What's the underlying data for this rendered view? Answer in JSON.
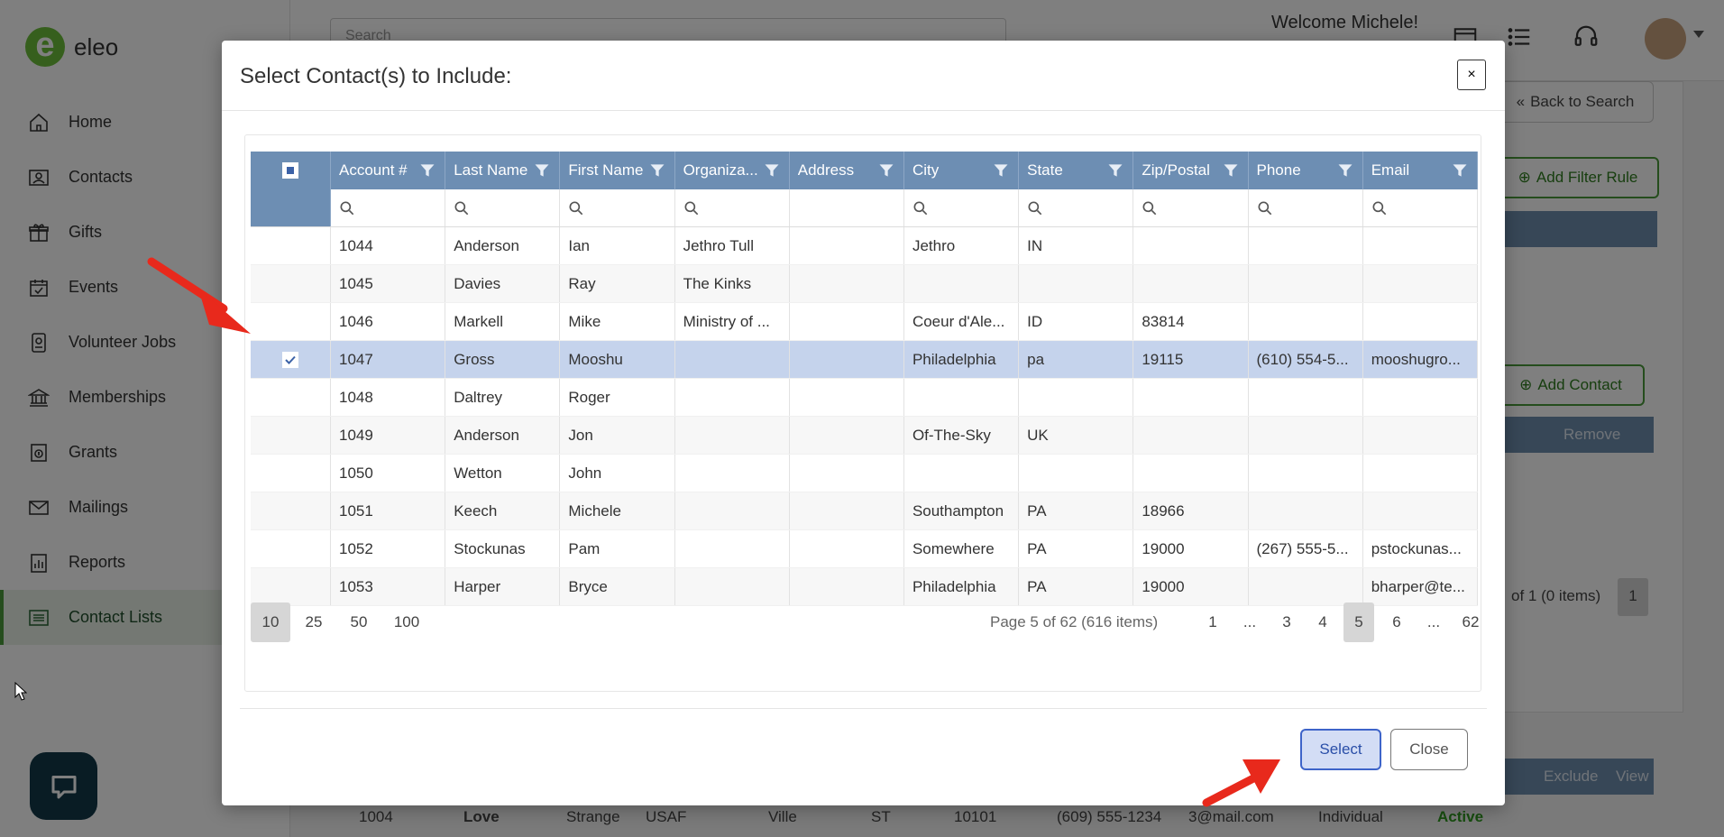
{
  "app": {
    "logo_text": "eleo",
    "search_placeholder": "Search",
    "welcome": "Welcome Michele!"
  },
  "sidebar": {
    "items": [
      {
        "label": "Home",
        "icon": "home-icon"
      },
      {
        "label": "Contacts",
        "icon": "contacts-icon"
      },
      {
        "label": "Gifts",
        "icon": "gift-icon"
      },
      {
        "label": "Events",
        "icon": "calendar-check-icon"
      },
      {
        "label": "Volunteer Jobs",
        "icon": "badge-icon"
      },
      {
        "label": "Memberships",
        "icon": "institution-icon"
      },
      {
        "label": "Grants",
        "icon": "grant-icon"
      },
      {
        "label": "Mailings",
        "icon": "envelope-icon"
      },
      {
        "label": "Reports",
        "icon": "report-icon"
      },
      {
        "label": "Contact Lists",
        "icon": "list-icon",
        "active": true
      }
    ]
  },
  "background": {
    "back_to_search": "Back to Search",
    "add_filter_rule": "Add Filter Rule",
    "add_contact": "Add Contact",
    "remove": "Remove",
    "pager_text": "of 1 (0 items)",
    "pager_page": "1",
    "exclude": "Exclude",
    "view": "View",
    "row": {
      "account": "1004",
      "last": "Love",
      "first": "Strange",
      "org": "USAF",
      "city": "Ville",
      "state": "ST",
      "zip": "10101",
      "phone": "(609) 555-1234",
      "email": "3@mail.com",
      "type": "Individual",
      "status": "Active"
    }
  },
  "modal": {
    "title": "Select Contact(s) to Include:",
    "close_x": "×",
    "columns": [
      "Account #",
      "Last Name",
      "First Name",
      "Organiza...",
      "Address",
      "City",
      "State",
      "Zip/Postal",
      "Phone",
      "Email"
    ],
    "rows": [
      {
        "checked": false,
        "cells": [
          "1044",
          "Anderson",
          "Ian",
          "Jethro Tull",
          "",
          "Jethro",
          "IN",
          "",
          "",
          ""
        ]
      },
      {
        "checked": false,
        "cells": [
          "1045",
          "Davies",
          "Ray",
          "The Kinks",
          "",
          "",
          "",
          "",
          "",
          ""
        ]
      },
      {
        "checked": false,
        "cells": [
          "1046",
          "Markell",
          "Mike",
          "Ministry of ...",
          "",
          "Coeur d'Ale...",
          "ID",
          "83814",
          "",
          ""
        ]
      },
      {
        "checked": true,
        "cells": [
          "1047",
          "Gross",
          "Mooshu",
          "",
          "",
          "Philadelphia",
          "pa",
          "19115",
          "(610) 554-5...",
          "mooshugro..."
        ]
      },
      {
        "checked": false,
        "cells": [
          "1048",
          "Daltrey",
          "Roger",
          "",
          "",
          "",
          "",
          "",
          "",
          ""
        ]
      },
      {
        "checked": false,
        "cells": [
          "1049",
          "Anderson",
          "Jon",
          "",
          "",
          "Of-The-Sky",
          "UK",
          "",
          "",
          ""
        ]
      },
      {
        "checked": false,
        "cells": [
          "1050",
          "Wetton",
          "John",
          "",
          "",
          "",
          "",
          "",
          "",
          ""
        ]
      },
      {
        "checked": false,
        "cells": [
          "1051",
          "Keech",
          "Michele",
          "",
          "",
          "Southampton",
          "PA",
          "18966",
          "",
          ""
        ]
      },
      {
        "checked": false,
        "cells": [
          "1052",
          "Stockunas",
          "Pam",
          "",
          "",
          "Somewhere",
          "PA",
          "19000",
          "(267) 555-5...",
          "pstockunas..."
        ]
      },
      {
        "checked": false,
        "cells": [
          "1053",
          "Harper",
          "Bryce",
          "",
          "",
          "Philadelphia",
          "PA",
          "19000",
          "",
          "bharper@te..."
        ]
      }
    ],
    "page_sizes": [
      "10",
      "25",
      "50",
      "100"
    ],
    "active_page_size": "10",
    "page_info": "Page 5 of 62 (616 items)",
    "pages": [
      "1",
      "...",
      "3",
      "4",
      "5",
      "6",
      "...",
      "62"
    ],
    "active_page": "5",
    "select_label": "Select",
    "close_label": "Close"
  },
  "colors": {
    "header_blue": "#6d8eb3",
    "selected_row": "#c5d3ec",
    "select_button": "#3e64c9",
    "brand_green": "#6cbf3a",
    "active_status": "#2e9b1e",
    "arrow_red": "#e8291c"
  }
}
